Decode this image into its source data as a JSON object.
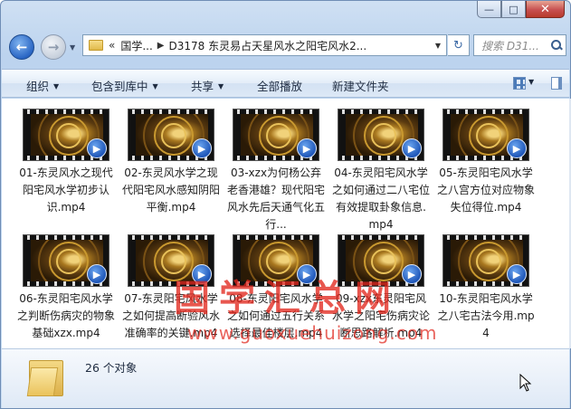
{
  "window": {
    "controls": {
      "minimize": "—",
      "maximize": "□",
      "close": "✕"
    }
  },
  "address": {
    "prefix": "«",
    "segments": [
      "国学...",
      "D3178 东灵易占天星风水之阳宅风水2..."
    ],
    "refresh_icon": "refresh-icon",
    "search_placeholder": "搜索 D31..."
  },
  "toolbar": {
    "organize": "组织",
    "include_in_library": "包含到库中",
    "share": "共享",
    "play_all": "全部播放",
    "new_folder": "新建文件夹"
  },
  "files": [
    {
      "name": "01-东灵风水之现代阳宅风水学初步认识.mp4"
    },
    {
      "name": "02-东灵风水学之现代阳宅风水感知阴阳平衡.mp4"
    },
    {
      "name": "03-xzx为何杨公弃老香港雄？现代阳宅风水先后天通气化五行..."
    },
    {
      "name": "04-东灵阳宅风水学之如何通过二八宅位有效提取卦象信息.mp4"
    },
    {
      "name": "05-东灵阳宅风水学之八宫方位对应物象失位得位.mp4"
    },
    {
      "name": "06-东灵阳宅风水学之判断伤病灾的物象基础xzx.mp4"
    },
    {
      "name": "07-东灵阳宅风水学之如何提高断验风水准确率的关键.mp4"
    },
    {
      "name": "08-东灵阳宅风水学之如何通过五行关系选择最佳楼层.mp4"
    },
    {
      "name": "09-xzx东灵阳宅风水学之阳宅伤病灾论断思路解析.mp4"
    },
    {
      "name": "10-东灵阳宅风水学之八宅古法今用.mp4"
    }
  ],
  "watermark": {
    "title": "国学汇总网",
    "url": "www.guoxuehuizong.com"
  },
  "status": {
    "count": "26 个对象"
  }
}
